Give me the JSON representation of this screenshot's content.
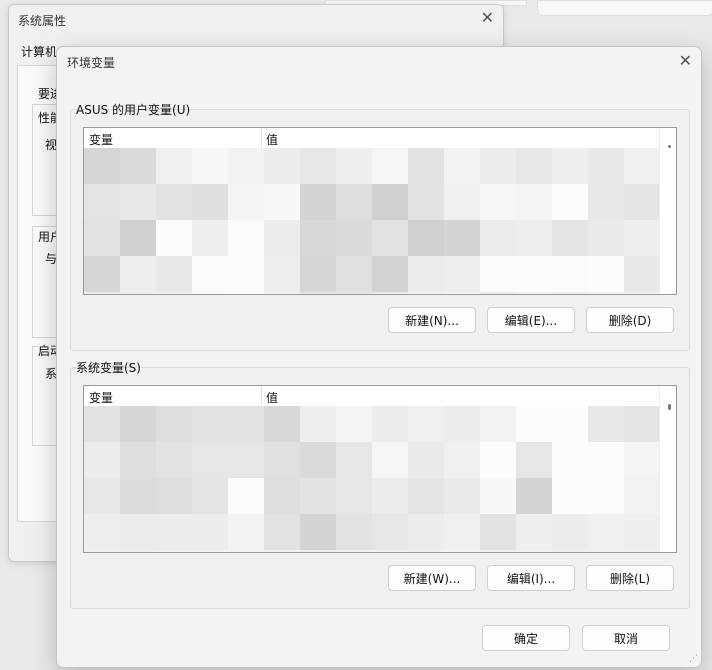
{
  "sysprops": {
    "title": "系统属性",
    "tab_computer_name": "计算机",
    "frag_1": "要进",
    "frag_2": "性能",
    "frag_3": "视",
    "frag_4": "用户",
    "frag_5": "与",
    "frag_6": "启动",
    "frag_7": "系"
  },
  "envvars": {
    "title": "环境变量",
    "user_group": {
      "title": "ASUS 的用户变量(U)",
      "col_name": "变量",
      "col_value": "值",
      "buttons": {
        "new": "新建(N)...",
        "edit": "编辑(E)...",
        "delete": "删除(D)"
      }
    },
    "system_group": {
      "title": "系统变量(S)",
      "col_name": "变量",
      "col_value": "值",
      "buttons": {
        "new": "新建(W)...",
        "edit": "编辑(I)...",
        "delete": "删除(L)"
      }
    },
    "ok": "确定",
    "cancel": "取消"
  },
  "icons": {
    "close": "close-icon"
  },
  "colors": {
    "window_bg": "#f3f3f3",
    "list_bg": "#ffffff",
    "button_bg": "#fdfdfd"
  }
}
